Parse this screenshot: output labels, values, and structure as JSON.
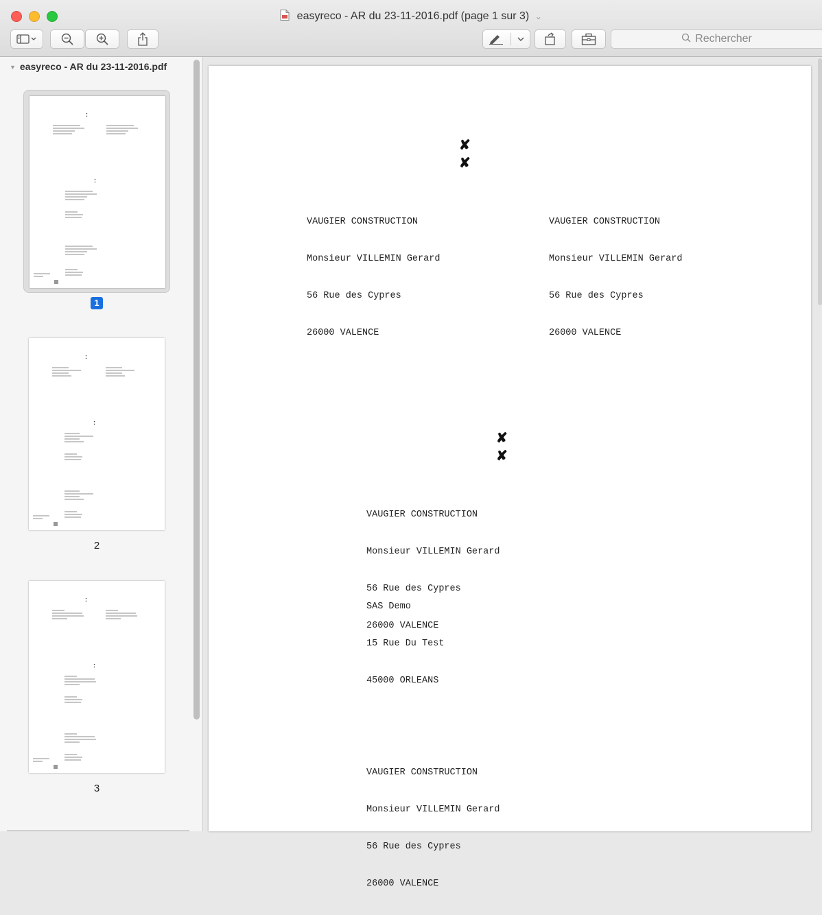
{
  "window": {
    "title": "easyreco - AR du 23-11-2016.pdf (page 1 sur 3)",
    "title_caret": "⌄"
  },
  "toolbar": {
    "search_placeholder": "Rechercher",
    "buttons": [
      "sidebar-toggle-icon",
      "zoom-out-icon",
      "zoom-in-icon",
      "share-icon",
      "markup-pen-icon",
      "rotate-icon",
      "toolbox-icon"
    ]
  },
  "sidebar": {
    "header": "easyreco - AR du 23-11-2016.pdf",
    "pages": [
      {
        "number": "1",
        "selected": true
      },
      {
        "number": "2",
        "selected": false
      },
      {
        "number": "3",
        "selected": false
      }
    ]
  },
  "page": {
    "marks": [
      "✘",
      "✘",
      "✘",
      "✘"
    ],
    "sender_left": {
      "company": "VAUGIER CONSTRUCTION",
      "contact": "Monsieur VILLEMIN Gerard",
      "street": "56 Rue des Cypres",
      "city": "26000 VALENCE"
    },
    "sender_right": {
      "company": "VAUGIER CONSTRUCTION",
      "contact": "Monsieur VILLEMIN Gerard",
      "street": "56 Rue des Cypres",
      "city": "26000 VALENCE"
    },
    "recipient_1": {
      "company": "VAUGIER CONSTRUCTION",
      "contact": "Monsieur VILLEMIN Gerard",
      "street": "56 Rue des Cypres",
      "city": "26000 VALENCE"
    },
    "return_address": {
      "company": "SAS Demo",
      "street": "15 Rue Du Test",
      "city": "45000 ORLEANS"
    },
    "recipient_2": {
      "company": "VAUGIER CONSTRUCTION",
      "contact": "Monsieur VILLEMIN Gerard",
      "street": "56 Rue des Cypres",
      "city": "26000 VALENCE"
    }
  },
  "colors": {
    "selected_badge": "#1a6fe0",
    "close": "#fc5f57",
    "minimize": "#fdbc2e",
    "zoom": "#28c940"
  }
}
